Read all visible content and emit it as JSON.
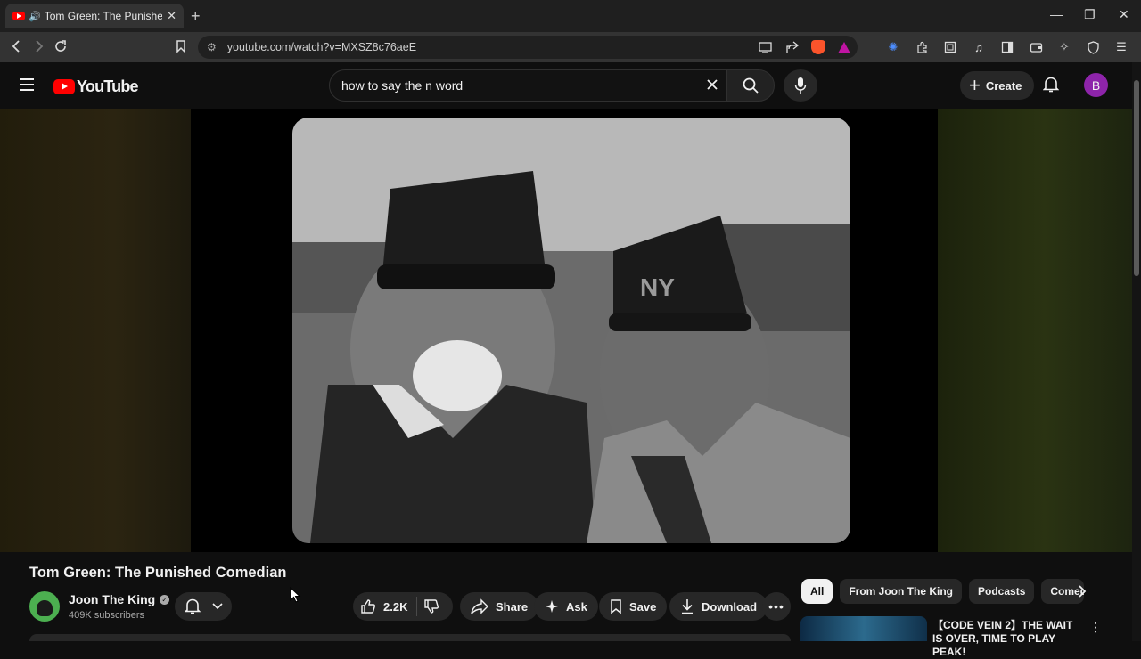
{
  "browser": {
    "tab_title": "Tom Green: The Punished Comedian",
    "tab_close": "✕",
    "new_tab": "+",
    "url": "youtube.com/watch?v=MXSZ8c76aeE",
    "window_controls": {
      "minimize": "—",
      "restore": "❐",
      "close": "✕"
    }
  },
  "youtube": {
    "logo_text": "YouTube",
    "search_query": "how to say the n word",
    "create_label": "Create",
    "avatar_letter": "B"
  },
  "video": {
    "title": "Tom Green: The Punished Comedian",
    "channel_name": "Joon The King",
    "subscribers": "409K subscribers",
    "likes": "2.2K",
    "share_label": "Share",
    "ask_label": "Ask",
    "save_label": "Save",
    "download_label": "Download"
  },
  "chips": [
    "All",
    "From Joon The King",
    "Podcasts",
    "Comedy"
  ],
  "recommendation": {
    "title": "【CODE VEIN 2】THE WAIT IS OVER, TIME TO PLAY PEAK!"
  },
  "colors": {
    "youtube_red": "#ff0000",
    "avatar": "#8e24aa",
    "background": "#0f0f0f"
  }
}
